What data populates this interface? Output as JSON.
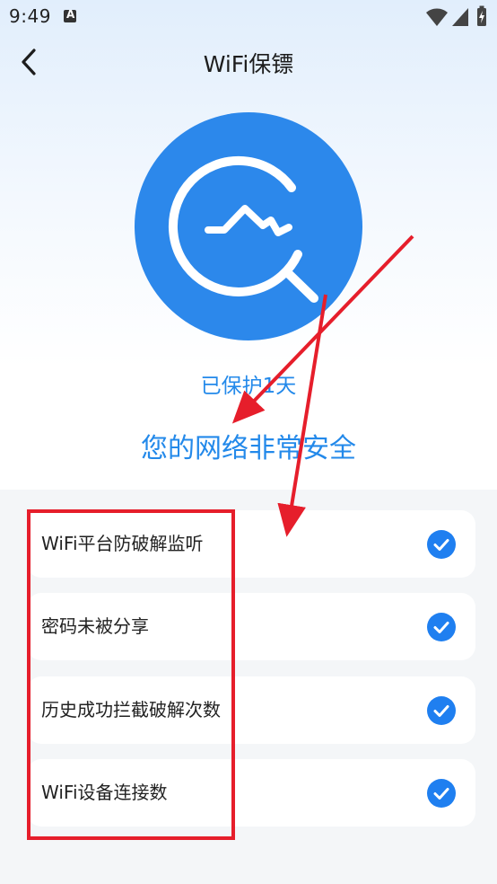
{
  "status_bar": {
    "time": "9:49",
    "notification_icon": "a-notification-icon",
    "wifi_icon": "wifi-icon",
    "signal_icon": "signal-icon",
    "battery_icon": "battery-charging-icon"
  },
  "nav": {
    "back_icon": "chevron-left-icon",
    "title": "WiFi保镖"
  },
  "hero": {
    "icon": "wifi-monitor-search-icon",
    "color": "#2c88eb",
    "protected_days": "已保护1天",
    "safe_status": "您的网络非常安全"
  },
  "checks": [
    {
      "label": "WiFi平台防破解监听",
      "status_icon": "check-icon"
    },
    {
      "label": "密码未被分享",
      "status_icon": "check-icon"
    },
    {
      "label": "历史成功拦截破解次数",
      "status_icon": "check-icon"
    },
    {
      "label": "WiFi设备连接数",
      "status_icon": "check-icon"
    }
  ],
  "colors": {
    "accent": "#2389ea",
    "check": "#1f7ff0",
    "annotation": "#e61e2b"
  }
}
